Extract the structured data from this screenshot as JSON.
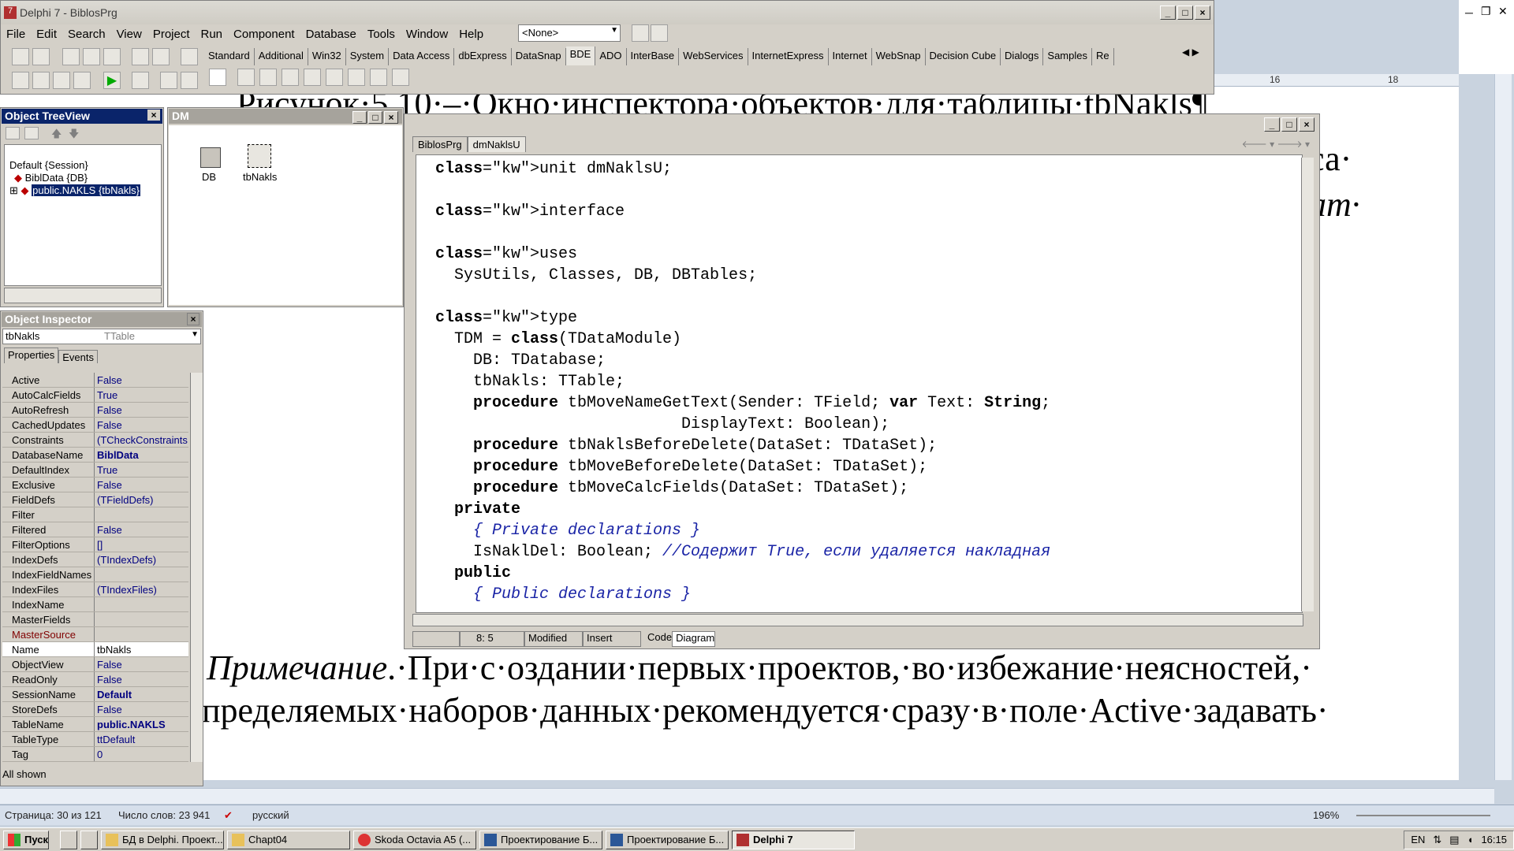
{
  "delphi": {
    "title": "Delphi 7 - BiblosPrg",
    "menu": [
      "File",
      "Edit",
      "Search",
      "View",
      "Project",
      "Run",
      "Component",
      "Database",
      "Tools",
      "Window",
      "Help"
    ],
    "config_combo": "<None>",
    "palette_tabs": [
      "Standard",
      "Additional",
      "Win32",
      "System",
      "Data Access",
      "dbExpress",
      "DataSnap",
      "BDE",
      "ADO",
      "InterBase",
      "WebServices",
      "InternetExpress",
      "Internet",
      "WebSnap",
      "Decision Cube",
      "Dialogs",
      "Samples",
      "Re"
    ]
  },
  "treeview": {
    "title": "Object TreeView",
    "items": [
      "Default {Session}",
      "BiblData {DB}",
      "public.NAKLS {tbNakls}"
    ]
  },
  "dm": {
    "title": "DM",
    "components": [
      "DB",
      "tbNakls"
    ]
  },
  "inspector": {
    "title": "Object Inspector",
    "object": "tbNakls",
    "type": "TTable",
    "tabs": [
      "Properties",
      "Events"
    ],
    "footer": "All shown",
    "props": [
      [
        "Active",
        "False"
      ],
      [
        "AutoCalcFields",
        "True"
      ],
      [
        "AutoRefresh",
        "False"
      ],
      [
        "CachedUpdates",
        "False"
      ],
      [
        "Constraints",
        "(TCheckConstraints"
      ],
      [
        "DatabaseName",
        "BiblData"
      ],
      [
        "DefaultIndex",
        "True"
      ],
      [
        "Exclusive",
        "False"
      ],
      [
        "FieldDefs",
        "(TFieldDefs)"
      ],
      [
        "Filter",
        ""
      ],
      [
        "Filtered",
        "False"
      ],
      [
        "FilterOptions",
        "[]"
      ],
      [
        "IndexDefs",
        "(TIndexDefs)"
      ],
      [
        "IndexFieldNames",
        ""
      ],
      [
        "IndexFiles",
        "(TIndexFiles)"
      ],
      [
        "IndexName",
        ""
      ],
      [
        "MasterFields",
        ""
      ],
      [
        "MasterSource",
        ""
      ],
      [
        "Name",
        "tbNakls"
      ],
      [
        "ObjectView",
        "False"
      ],
      [
        "ReadOnly",
        "False"
      ],
      [
        "SessionName",
        "Default"
      ],
      [
        "StoreDefs",
        "False"
      ],
      [
        "TableName",
        "public.NAKLS"
      ],
      [
        "TableType",
        "ttDefault"
      ],
      [
        "Tag",
        "0"
      ]
    ]
  },
  "editor": {
    "tabs": [
      "BiblosPrg",
      "dmNaklsU"
    ],
    "status_pos": "8:  5",
    "status_mod": "Modified",
    "status_ins": "Insert",
    "bottom_tabs": [
      "Code",
      "Diagram"
    ],
    "code": [
      "unit dmNaklsU;",
      "",
      "interface",
      "",
      "uses",
      "  SysUtils, Classes, DB, DBTables;",
      "",
      "type",
      "  TDM = class(TDataModule)",
      "    DB: TDatabase;",
      "    tbNakls: TTable;",
      "    procedure tbMoveNameGetText(Sender: TField; var Text: String;",
      "                          DisplayText: Boolean);",
      "    procedure tbNaklsBeforeDelete(DataSet: TDataSet);",
      "    procedure tbMoveBeforeDelete(DataSet: TDataSet);",
      "    procedure tbMoveCalcFields(DataSet: TDataSet);",
      "  private",
      "    { Private declarations }",
      "    IsNaklDel: Boolean; //Содержит True, если удаляется накладная",
      "  public",
      "    { Public declarations }"
    ]
  },
  "word": {
    "line_top": "Рисунок·5.10·–·Окно·инспектора·объектов·для·таблицы·tbNakls¶",
    "frag1": "са·",
    "frag2": "ат·",
    "note1_italic": "Примечание",
    "note1_rest": ".·При·с·оздании·первых·проектов,·во·избежание·неясностей,·",
    "note2": "пределяемых·наборов·данных·рекомендуется·сразу·в·поле·Active·задавать·",
    "ruler": [
      "16",
      "18"
    ],
    "status": {
      "page": "Страница: 30 из 121",
      "words": "Число слов: 23 941",
      "lang": "русский",
      "zoom": "196%"
    }
  },
  "taskbar": {
    "start": "Пуск",
    "items": [
      "БД в Delphi. Проект...",
      "Chapt04",
      "Skoda Octavia A5 (...",
      "Проектирование Б...",
      "Проектирование Б...",
      "Delphi 7"
    ],
    "lang": "EN",
    "clock": "16:15"
  }
}
